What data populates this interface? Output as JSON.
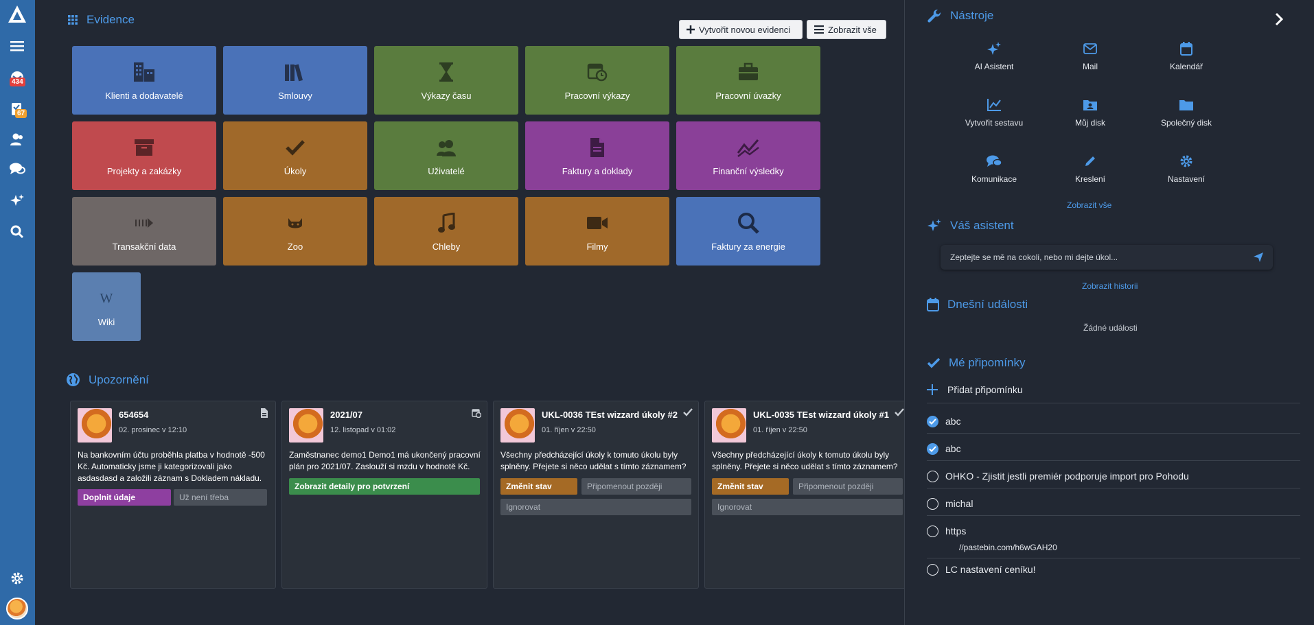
{
  "colors": {
    "sidebar": "#2f6aa8",
    "accent": "#4d9ae8",
    "tile_blue": "#4a72b8",
    "tile_green": "#5a7c3e",
    "tile_red": "#c04a4e",
    "tile_orange": "#a0692a",
    "tile_purple": "#8a4098",
    "tile_grey": "#6e6766",
    "tile_lightblue": "#5b7fb0"
  },
  "sidebar": {
    "badges": {
      "mail": "434",
      "tasks": "67"
    }
  },
  "evidence": {
    "title": "Evidence",
    "create_label": "Vytvořit novou evidenci",
    "show_all_label": "Zobrazit vše",
    "tiles": [
      {
        "label": "Klienti a dodavatelé",
        "icon": "building-icon",
        "color": "#4a72b8"
      },
      {
        "label": "Smlouvy",
        "icon": "books-icon",
        "color": "#4a72b8"
      },
      {
        "label": "Výkazy času",
        "icon": "hourglass-icon",
        "color": "#5a7c3e"
      },
      {
        "label": "Pracovní výkazy",
        "icon": "calendar-clock-icon",
        "color": "#5a7c3e"
      },
      {
        "label": "Pracovní úvazky",
        "icon": "briefcase-icon",
        "color": "#5a7c3e"
      },
      {
        "label": "Projekty a zakázky",
        "icon": "archive-box-icon",
        "color": "#c04a4e"
      },
      {
        "label": "Úkoly",
        "icon": "check-icon",
        "color": "#a0692a"
      },
      {
        "label": "Uživatelé",
        "icon": "users-icon",
        "color": "#5a7c3e"
      },
      {
        "label": "Faktury a doklady",
        "icon": "document-icon",
        "color": "#8a4098"
      },
      {
        "label": "Finanční výsledky",
        "icon": "trend-icon",
        "color": "#8a4098"
      },
      {
        "label": "Transakční data",
        "icon": "transfer-icon",
        "color": "#6e6766"
      },
      {
        "label": "Zoo",
        "icon": "cat-icon",
        "color": "#a0692a"
      },
      {
        "label": "Chleby",
        "icon": "music-icon",
        "color": "#a0692a"
      },
      {
        "label": "Filmy",
        "icon": "video-icon",
        "color": "#a0692a"
      },
      {
        "label": "Faktury za energie",
        "icon": "search-icon",
        "color": "#4a72b8"
      },
      {
        "label": "Wiki",
        "icon": "wikipedia-icon",
        "color": "#5b7fb0"
      }
    ]
  },
  "notifications": {
    "title": "Upozornění",
    "cards": [
      {
        "title": "654654",
        "date": "02. prosinec v 12:10",
        "type_icon": "document-icon",
        "text": "Na bankovním účtu proběhla platba v hodnotě -500 Kč. Automaticky jsme ji kategorizovali jako asdasdasd a založili záznam s Dokladem nákladu.",
        "buttons": [
          {
            "label": "Doplnit údaje",
            "style": "purple"
          },
          {
            "label": "Už není třeba",
            "style": "grey"
          }
        ]
      },
      {
        "title": "2021/07",
        "date": "12. listopad v 01:02",
        "type_icon": "calendar-clock-icon",
        "text": "Zaměstnanec demo1 Demo1 má ukončený pracovní plán pro 2021/07. Zaslouží si mzdu v hodnotě Kč.",
        "buttons": [
          {
            "label": "Zobrazit detaily pro potvrzení",
            "style": "green"
          }
        ]
      },
      {
        "title": "UKL-0036 TEst wizzard úkoly #2",
        "date": "01. říjen v 22:50",
        "type_icon": "check-icon",
        "text": "Všechny předcházející úkoly k tomuto úkolu byly splněny. Přejete si něco udělat s tímto záznamem?",
        "buttons": [
          {
            "label": "Změnit stav",
            "style": "orange"
          },
          {
            "label": "Připomenout později",
            "style": "grey"
          },
          {
            "label": "Ignorovat",
            "style": "grey"
          }
        ]
      },
      {
        "title": "UKL-0035 TEst wizzard úkoly #1",
        "date": "01. říjen v 22:50",
        "type_icon": "check-icon",
        "text": "Všechny předcházející úkoly k tomuto úkolu byly splněny. Přejete si něco udělat s tímto záznamem?",
        "buttons": [
          {
            "label": "Změnit stav",
            "style": "orange"
          },
          {
            "label": "Připomenout později",
            "style": "grey"
          },
          {
            "label": "Ignorovat",
            "style": "grey"
          }
        ]
      }
    ]
  },
  "tools": {
    "title": "Nástroje",
    "items": [
      {
        "label": "AI Asistent",
        "icon": "sparkles-icon"
      },
      {
        "label": "Mail",
        "icon": "mail-icon"
      },
      {
        "label": "Kalendář",
        "icon": "calendar-icon"
      },
      {
        "label": "Vytvořit sestavu",
        "icon": "chart-line-icon"
      },
      {
        "label": "Můj disk",
        "icon": "user-folder-icon"
      },
      {
        "label": "Společný disk",
        "icon": "folder-icon"
      },
      {
        "label": "Komunikace",
        "icon": "chat-icon"
      },
      {
        "label": "Kreslení",
        "icon": "pencil-icon"
      },
      {
        "label": "Nastavení",
        "icon": "gear-icon"
      }
    ],
    "show_all": "Zobrazit vše"
  },
  "assistant": {
    "title": "Váš asistent",
    "placeholder": "Zeptejte se mě na cokoli, nebo mi dejte úkol...",
    "history_link": "Zobrazit historii"
  },
  "events": {
    "title": "Dnešní události",
    "empty": "Žádné události"
  },
  "reminders": {
    "title": "Mé připomínky",
    "add_label": "Přidat připomínku",
    "items": [
      {
        "text": "abc",
        "done": true,
        "sub": ""
      },
      {
        "text": "abc",
        "done": true,
        "sub": ""
      },
      {
        "text": "OHKO - Zjistit jestli premiér podporuje import pro Pohodu",
        "done": false,
        "sub": ""
      },
      {
        "text": "michal",
        "done": false,
        "sub": ""
      },
      {
        "text": "https",
        "done": false,
        "sub": "//pastebin.com/h6wGAH20"
      },
      {
        "text": "LC nastavení ceníku!",
        "done": false,
        "sub": ""
      }
    ]
  }
}
